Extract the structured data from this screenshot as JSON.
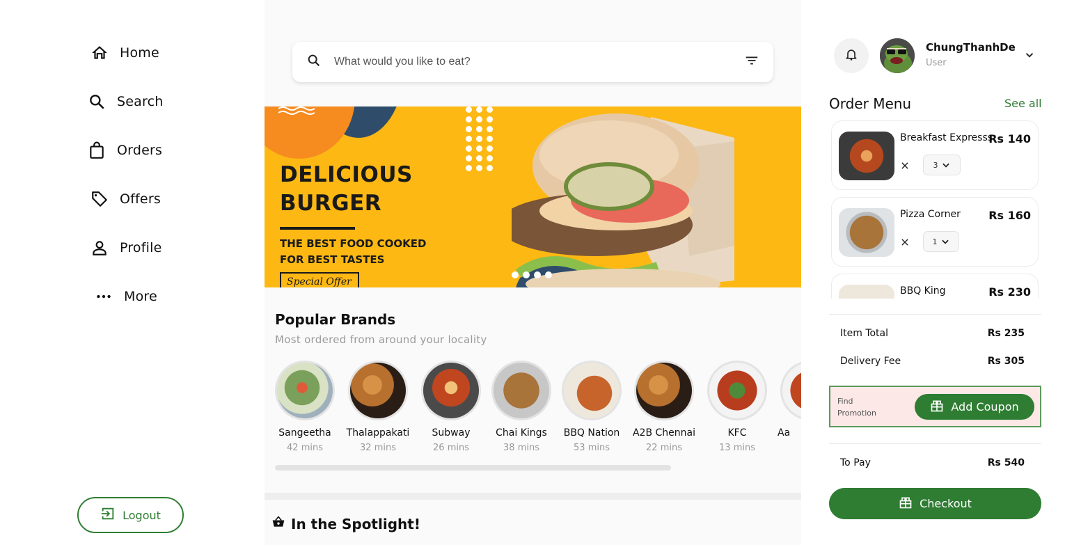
{
  "sidebar": {
    "items": [
      {
        "label": "Home",
        "icon": "home-icon"
      },
      {
        "label": "Search",
        "icon": "search-icon"
      },
      {
        "label": "Orders",
        "icon": "shopping-bag-icon"
      },
      {
        "label": "Offers",
        "icon": "tag-icon"
      },
      {
        "label": "Profile",
        "icon": "person-icon"
      },
      {
        "label": "More",
        "icon": "more-horizontal-icon"
      }
    ],
    "logout_label": "Logout"
  },
  "main": {
    "search": {
      "placeholder": "What would you like to eat?"
    },
    "banner": {
      "title_line1": "DELICIOUS",
      "title_line2": "BURGER",
      "sub_line1": "THE BEST FOOD COOKED",
      "sub_line2": "FOR BEST TASTES",
      "offer_label": "Special Offer",
      "slide_count": 4
    },
    "popular": {
      "title": "Popular Brands",
      "subtitle": "Most ordered from around your locality",
      "brands": [
        {
          "name": "Sangeetha",
          "time": "42 mins",
          "color": "#7ba05b"
        },
        {
          "name": "Thalappakati",
          "time": "32 mins",
          "color": "#b8702f"
        },
        {
          "name": "Subway",
          "time": "26 mins",
          "color": "#c0461f"
        },
        {
          "name": "Chai Kings",
          "time": "38 mins",
          "color": "#a8743a"
        },
        {
          "name": "BBQ Nation",
          "time": "53 mins",
          "color": "#c7642b"
        },
        {
          "name": "A2B Chennai",
          "time": "22 mins",
          "color": "#b8702f"
        },
        {
          "name": "KFC",
          "time": "13 mins",
          "color": "#b83d1f"
        },
        {
          "name": "Aa",
          "time": "",
          "color": "#c0461f"
        }
      ]
    },
    "spotlight": {
      "title": "In the Spotlight!"
    }
  },
  "user": {
    "name": "ChungThanhDe",
    "role": "User"
  },
  "order_menu": {
    "title": "Order Menu",
    "see_all": "See all",
    "items": [
      {
        "name": "Breakfast Expresss",
        "price": "Rs 140",
        "qty": "3",
        "color": "#b5481e"
      },
      {
        "name": "Pizza Corner",
        "price": "Rs 160",
        "qty": "1",
        "color": "#a8743a"
      },
      {
        "name": "BBQ King",
        "price": "Rs 230",
        "qty": "",
        "color": "#c7642b"
      }
    ],
    "item_total_label": "Item Total",
    "item_total": "Rs 235",
    "delivery_label": "Delivery Fee",
    "delivery": "Rs 305",
    "promo_label": "Find Promotion",
    "coupon_label": "Add Coupon",
    "to_pay_label": "To Pay",
    "to_pay": "Rs 540",
    "checkout_label": "Checkout"
  },
  "colors": {
    "accent": "#2e7d32",
    "banner": "#fdb813",
    "promo_bg": "#fce8e6"
  }
}
